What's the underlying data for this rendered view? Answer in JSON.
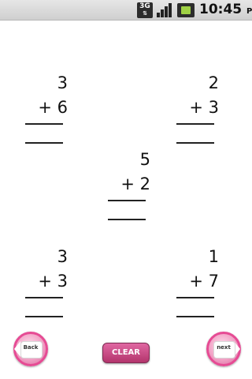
{
  "status_bar": {
    "network_label": "3G",
    "time": "10:45",
    "ampm": "PM",
    "icons": [
      "network-3g-icon",
      "signal-strength-icon",
      "battery-icon"
    ]
  },
  "problems": [
    {
      "top": "3",
      "bottom": "+ 6"
    },
    {
      "top": "2",
      "bottom": "+ 3"
    },
    {
      "top": "5",
      "bottom": "+ 2"
    },
    {
      "top": "3",
      "bottom": "+ 3"
    },
    {
      "top": "1",
      "bottom": "+ 7"
    }
  ],
  "controls": {
    "back_label": "Back",
    "clear_label": "CLEAR",
    "next_label": "next"
  },
  "colors": {
    "accent_pink": "#e64b94",
    "clear_button": "#c2467f"
  }
}
